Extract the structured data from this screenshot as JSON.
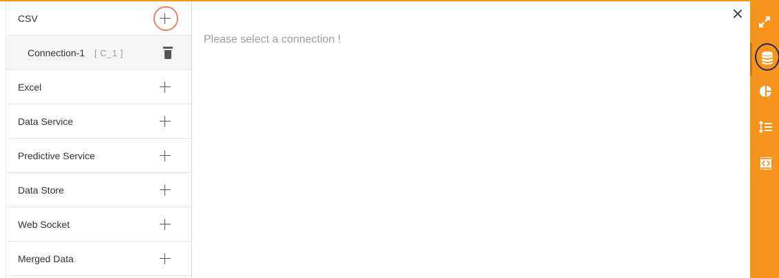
{
  "sidebar": {
    "items": [
      {
        "label": "CSV"
      },
      {
        "label": "Connection-1",
        "ref": "[ C_1 ]"
      },
      {
        "label": "Excel"
      },
      {
        "label": "Data Service"
      },
      {
        "label": "Predictive Service"
      },
      {
        "label": "Data Store"
      },
      {
        "label": "Web Socket"
      },
      {
        "label": "Merged Data"
      }
    ]
  },
  "main": {
    "message": "Please select a connection !"
  },
  "toolbar": {
    "icons": [
      "expand-icon",
      "database-icon",
      "pie-chart-icon",
      "sort-list-icon",
      "code-icon"
    ],
    "accent_color": "#f7941d"
  },
  "colors": {
    "highlight_ring": "#ef7f5a",
    "active_ring": "#1e2a55"
  }
}
